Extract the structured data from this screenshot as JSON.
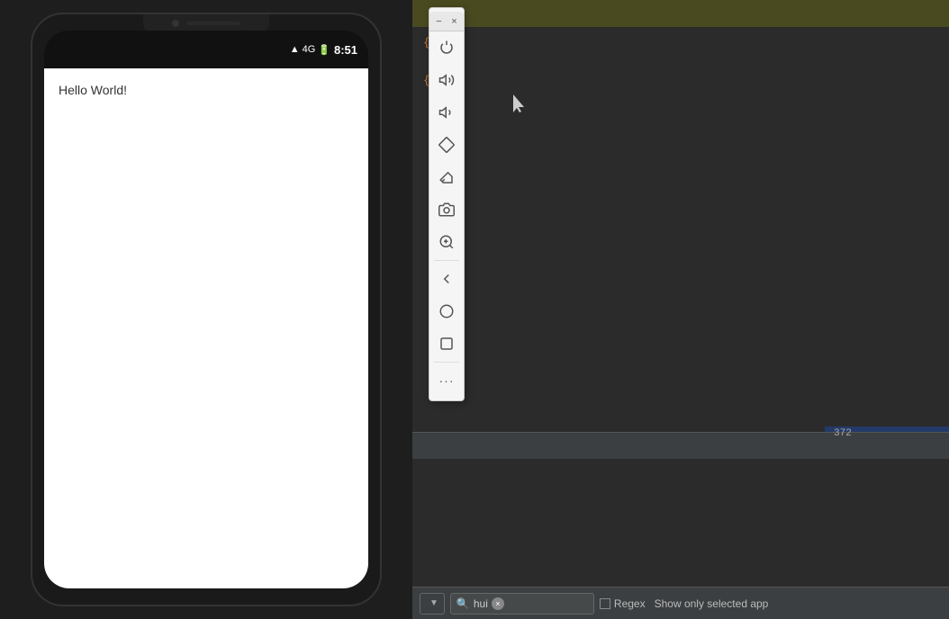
{
  "phone": {
    "time": "8:51",
    "hello_text": "Hello World!",
    "camera_alt": "camera",
    "speaker_alt": "speaker"
  },
  "editor": {
    "code_lines": [
      "{ ",
      "  ",
      "{",
      "  "
    ],
    "line_number": "372"
  },
  "floating_toolbar": {
    "minimize_label": "−",
    "close_label": "×",
    "icons": [
      {
        "name": "power-icon",
        "symbol": "⏻"
      },
      {
        "name": "volume-high-icon",
        "symbol": "🔊"
      },
      {
        "name": "volume-low-icon",
        "symbol": "🔉"
      },
      {
        "name": "rotate-icon",
        "symbol": "◇"
      },
      {
        "name": "eraser-icon",
        "symbol": "◻"
      },
      {
        "name": "camera-icon",
        "symbol": "📷"
      },
      {
        "name": "zoom-in-icon",
        "symbol": "🔍"
      },
      {
        "name": "back-icon",
        "symbol": "◁"
      },
      {
        "name": "home-icon",
        "symbol": "○"
      },
      {
        "name": "square-icon",
        "symbol": "□"
      },
      {
        "name": "more-icon",
        "symbol": "···"
      }
    ]
  },
  "bottom_toolbar": {
    "dropdown_label": "",
    "search_value": "hui",
    "search_placeholder": "Search",
    "regex_label": "Regex",
    "show_selected_label": "Show only selected app",
    "clear_label": "×"
  },
  "colors": {
    "ide_bg": "#2b2b2b",
    "ide_header": "#4a4a20",
    "toolbar_bg": "#f5f5f5",
    "bottom_bar": "#3c3f41",
    "blue_highlight": "#214283"
  }
}
